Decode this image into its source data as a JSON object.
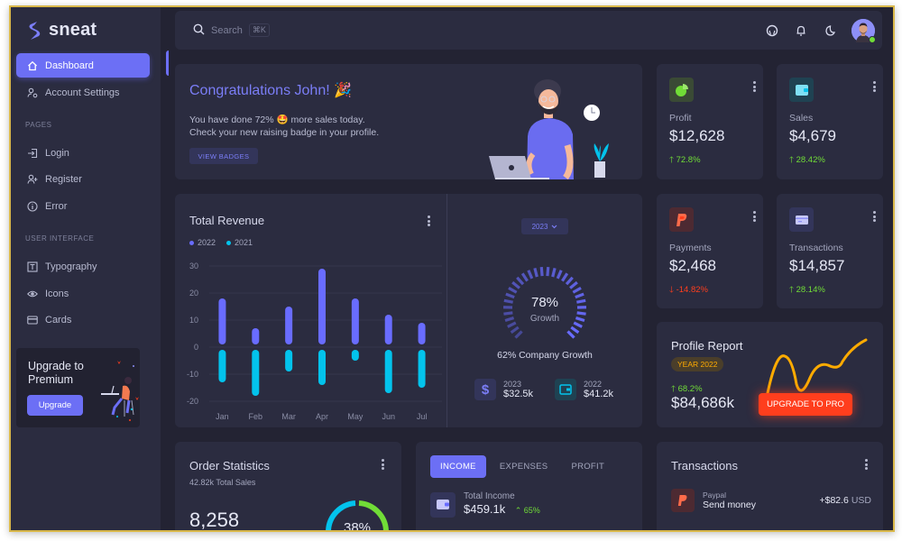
{
  "brand": {
    "name": "sneat"
  },
  "sidebar": {
    "items": [
      {
        "label": "Dashboard",
        "icon": "home-icon",
        "active": true
      },
      {
        "label": "Account Settings",
        "icon": "user-gear-icon"
      }
    ],
    "sections": [
      {
        "title": "PAGES",
        "items": [
          {
            "label": "Login",
            "icon": "login-icon"
          },
          {
            "label": "Register",
            "icon": "user-plus-icon"
          },
          {
            "label": "Error",
            "icon": "info-circle-icon"
          }
        ]
      },
      {
        "title": "USER INTERFACE",
        "items": [
          {
            "label": "Typography",
            "icon": "text-box-icon"
          },
          {
            "label": "Icons",
            "icon": "eye-icon"
          },
          {
            "label": "Cards",
            "icon": "credit-card-icon"
          }
        ]
      }
    ],
    "upgrade": {
      "title": "Upgrade to Premium",
      "button": "Upgrade"
    }
  },
  "topbar": {
    "search_placeholder": "Search",
    "search_shortcut": "⌘K",
    "icons": [
      "github-icon",
      "bell-icon",
      "moon-icon"
    ],
    "user_status": "online"
  },
  "congrats": {
    "title": "Congratulations John! 🎉",
    "line1": "You have done 72% 🤩 more sales today.",
    "line2": "Check your new raising badge in your profile.",
    "button": "VIEW BADGES"
  },
  "stats": [
    {
      "label": "Profit",
      "value": "$12,628",
      "change": "72.8%",
      "direction": "up",
      "icon": "pie-chart-icon",
      "color": "#71dd37"
    },
    {
      "label": "Sales",
      "value": "$4,679",
      "change": "28.42%",
      "direction": "up",
      "icon": "wallet-icon",
      "color": "#03c3ec"
    },
    {
      "label": "Payments",
      "value": "$2,468",
      "change": "-14.82%",
      "direction": "down",
      "icon": "paypal-icon",
      "color": "#ff3e1d"
    },
    {
      "label": "Transactions",
      "value": "$14,857",
      "change": "28.14%",
      "direction": "up",
      "icon": "credit-card-icon",
      "color": "#696cff"
    }
  ],
  "revenue": {
    "title": "Total Revenue",
    "year_select": "2023",
    "growth_percent": "78%",
    "growth_percent_value": 78,
    "growth_label": "Growth",
    "company_growth": "62% Company Growth",
    "mini_stats": [
      {
        "year": "2023",
        "value": "$32.5k",
        "icon": "dollar-icon"
      },
      {
        "year": "2022",
        "value": "$41.2k",
        "icon": "wallet-icon"
      }
    ]
  },
  "chart_data": {
    "type": "bar",
    "title": "Total Revenue",
    "categories": [
      "Jan",
      "Feb",
      "Mar",
      "Apr",
      "May",
      "Jun",
      "Jul"
    ],
    "series": [
      {
        "name": "2022",
        "color": "#696cff",
        "values": [
          18,
          7,
          15,
          29,
          18,
          12,
          9
        ]
      },
      {
        "name": "2021",
        "color": "#03c3ec",
        "values": [
          -13,
          -18,
          -9,
          -14,
          -5,
          -17,
          -15
        ]
      }
    ],
    "yticks": [
      30,
      20,
      10,
      0,
      -10,
      -20
    ],
    "ylim": [
      -20,
      30
    ],
    "grid": true,
    "legend": "top-left",
    "xlabel": "",
    "ylabel": ""
  },
  "profile_report": {
    "title": "Profile Report",
    "badge": "YEAR 2022",
    "change": "68.2%",
    "value": "$84,686k",
    "button": "UPGRADE TO PRO"
  },
  "order_stats": {
    "title": "Order Statistics",
    "subtitle": "42.82k Total Sales",
    "count": "8,258",
    "donut_percent": "38%"
  },
  "income": {
    "tabs": [
      "INCOME",
      "EXPENSES",
      "PROFIT"
    ],
    "active_tab": 0,
    "label": "Total Income",
    "value": "$459.1k",
    "change": "65%"
  },
  "transactions": {
    "title": "Transactions",
    "items": [
      {
        "name": "Paypal",
        "desc": "Send money",
        "amount": "+$82.6",
        "currency": "USD"
      }
    ]
  }
}
